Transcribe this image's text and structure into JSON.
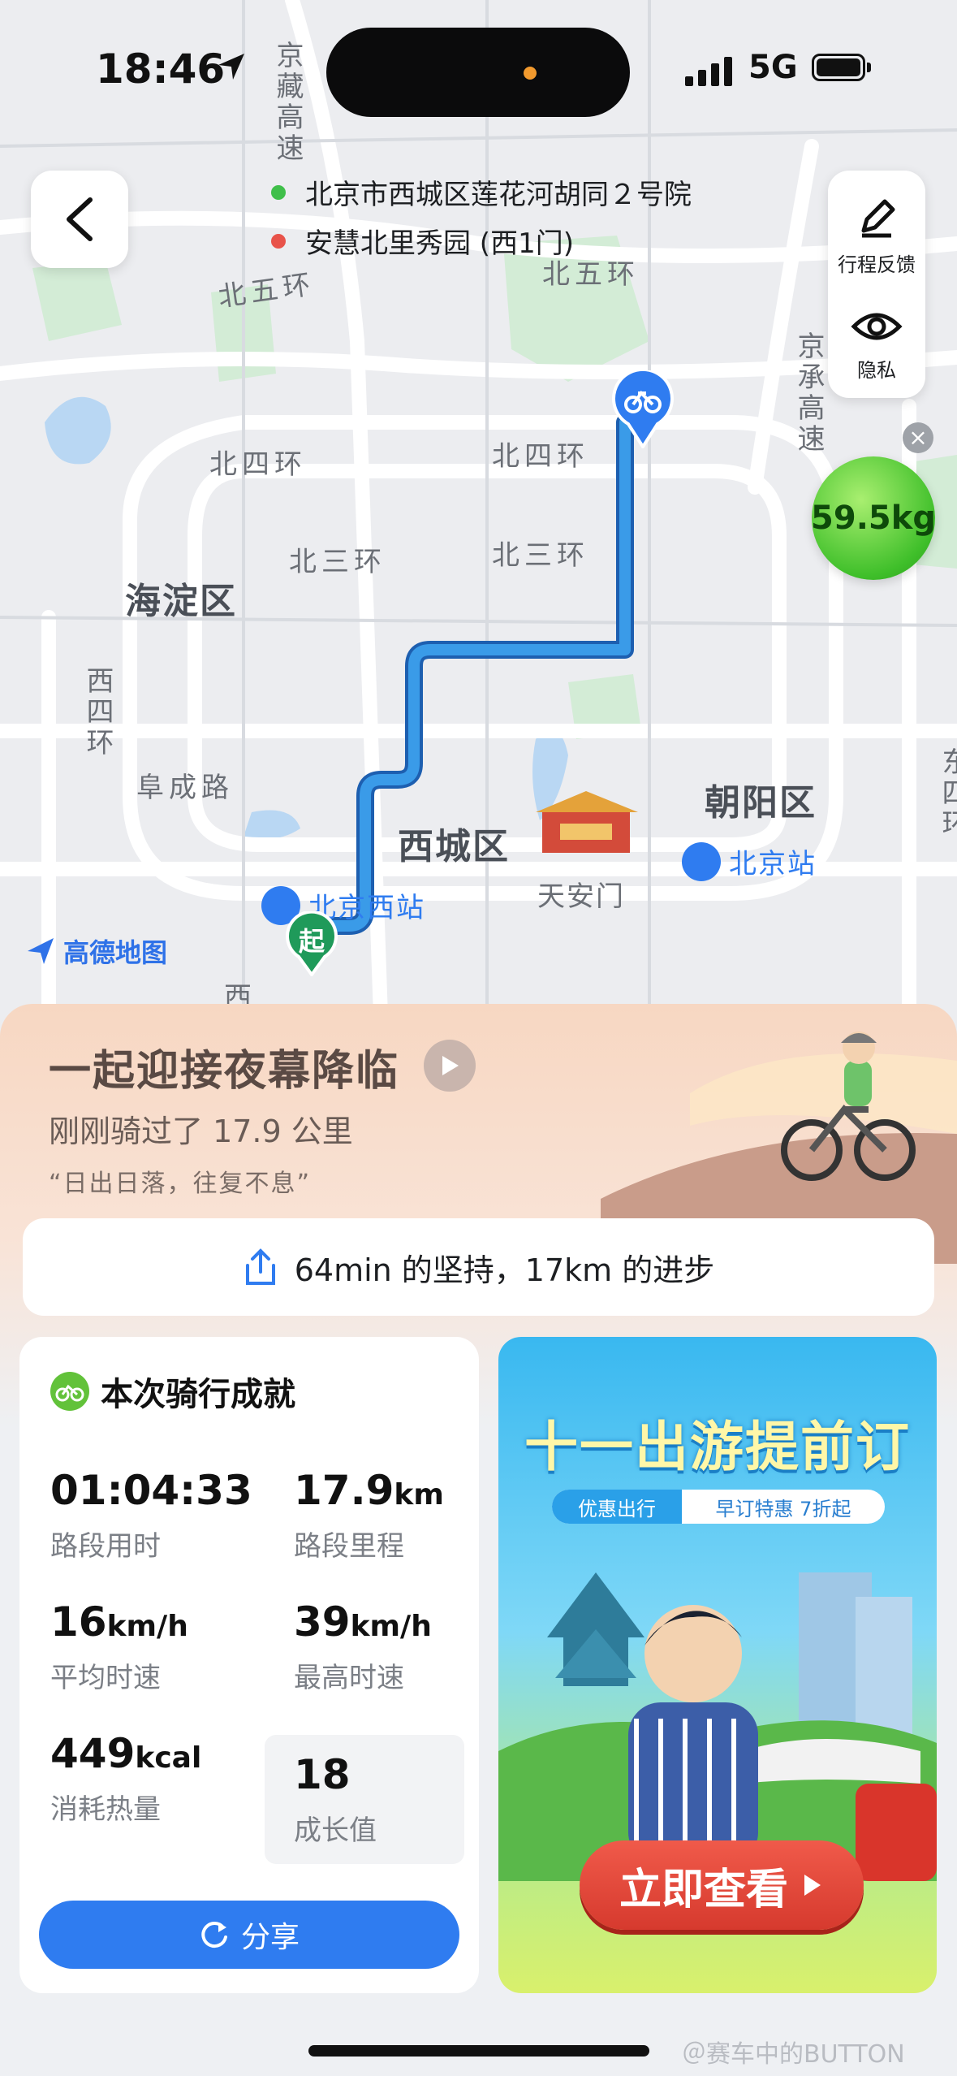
{
  "status_bar": {
    "time": "18:46",
    "network": "5G"
  },
  "route": {
    "start": "北京市西城区莲花河胡同２号院",
    "end": "安慧北里秀园 (西1门)",
    "start_color": "#3fbf4a",
    "end_color": "#e8534a"
  },
  "side_tools": {
    "feedback_label": "行程反馈",
    "privacy_label": "隐私"
  },
  "carbon_badge": "59.5kg",
  "map": {
    "ring5_a": "北五环",
    "ring5_b": "北五环",
    "ring4_a": "北四环",
    "ring4_b": "北四环",
    "ring3_a": "北三环",
    "ring3_b": "北三环",
    "highway_a": "京藏高速",
    "highway_b": "京承高速",
    "west_ring4": "西四环",
    "east_ring": "东四环",
    "fucheng": "阜成路",
    "haidian": "海淀区",
    "xicheng": "西城区",
    "chaoyang": "朝阳区",
    "tiananmen": "天安门",
    "beijing_station": "北京站",
    "beijing_west": "北京西站",
    "start_marker": "起",
    "bottom_cut": "西",
    "logo": "高德地图",
    "route_color": "#3a9be8"
  },
  "banner": {
    "title": "一起迎接夜幕降临",
    "subtitle": "刚刚骑过了 17.9 公里",
    "quote": "“日出日落，往复不息”",
    "share_text": "64min 的坚持，17km 的进步"
  },
  "stats": {
    "heading": "本次骑行成就",
    "items": [
      {
        "value": "01:04:33",
        "unit": "",
        "label": "路段用时"
      },
      {
        "value": "17.9",
        "unit": "km",
        "label": "路段里程"
      },
      {
        "value": "16",
        "unit": "km/h",
        "label": "平均时速"
      },
      {
        "value": "39",
        "unit": "km/h",
        "label": "最高时速"
      },
      {
        "value": "449",
        "unit": "kcal",
        "label": "消耗热量"
      },
      {
        "value": "18",
        "unit": "",
        "label": "成长值"
      }
    ],
    "share_button": "分享"
  },
  "ad": {
    "title": "十一出游提前订",
    "tag_a": "优惠出行",
    "tag_b": "早订特惠 7折起",
    "cta": "立即查看"
  },
  "watermark": "＠赛车中的BUTTON"
}
